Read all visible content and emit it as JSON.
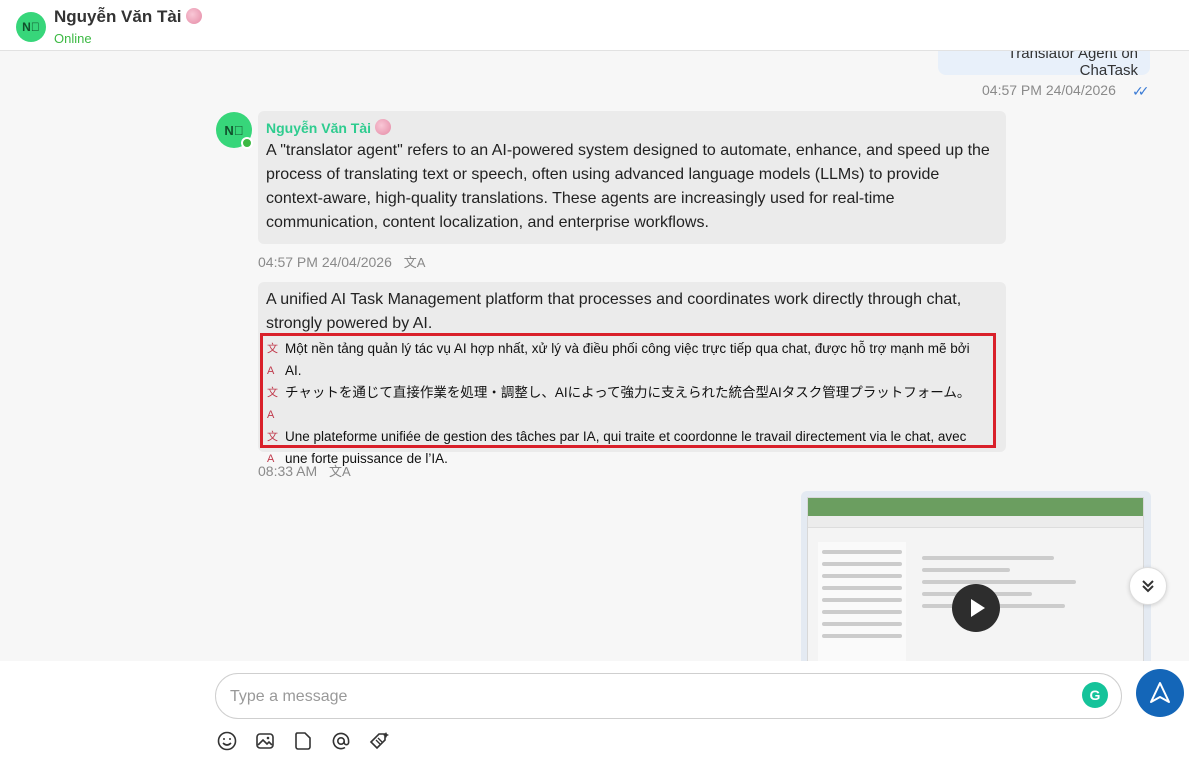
{
  "header": {
    "avatar_initials": "N󰀀",
    "name": "Nguyễn Văn Tài",
    "status": "Online",
    "status_color": "#3cb943"
  },
  "messages": {
    "outgoing_top": {
      "text": "Translator Agent on ChaTask",
      "time": "04:57 PM 24/04/2026"
    },
    "incoming_1": {
      "avatar_initials": "N󰀀",
      "sender": "Nguyễn Văn Tài",
      "text": "A \"translator agent\" refers to an AI-powered system designed to automate, enhance, and speed up the process of translating text or speech, often using advanced language models (LLMs) to provide context-aware, high-quality translations. These agents are increasingly used for real-time communication, content localization, and enterprise workflows.",
      "time": "04:57 PM 24/04/2026"
    },
    "incoming_2": {
      "text": "A unified AI Task Management platform that processes and coordinates work directly through chat, strongly powered by AI.",
      "translations": [
        "Một nền tảng quản lý tác vụ AI hợp nhất, xử lý và điều phối công việc trực tiếp qua chat, được hỗ trợ mạnh mẽ bởi AI.",
        "チャットを通じて直接作業を処理・調整し、AIによって強力に支えられた統合型AIタスク管理プラットフォーム。",
        "Une plateforme unifiée de gestion des tâches par IA, qui traite et coordonne le travail directement via le chat, avec une forte puissance de l’IA."
      ],
      "time": "08:33 AM"
    }
  },
  "composer": {
    "placeholder": "Type a message"
  },
  "icons": {
    "translate": "translate-icon",
    "emoji": "emoji-icon",
    "image": "image-icon",
    "file": "file-icon",
    "mention": "mention-icon",
    "tag": "tag-icon",
    "send": "send-icon",
    "scroll": "chevron-double-down-icon"
  },
  "colors": {
    "accent": "#1466b8",
    "sender_name": "#2ecc8f",
    "highlight_border": "#d9202a"
  }
}
